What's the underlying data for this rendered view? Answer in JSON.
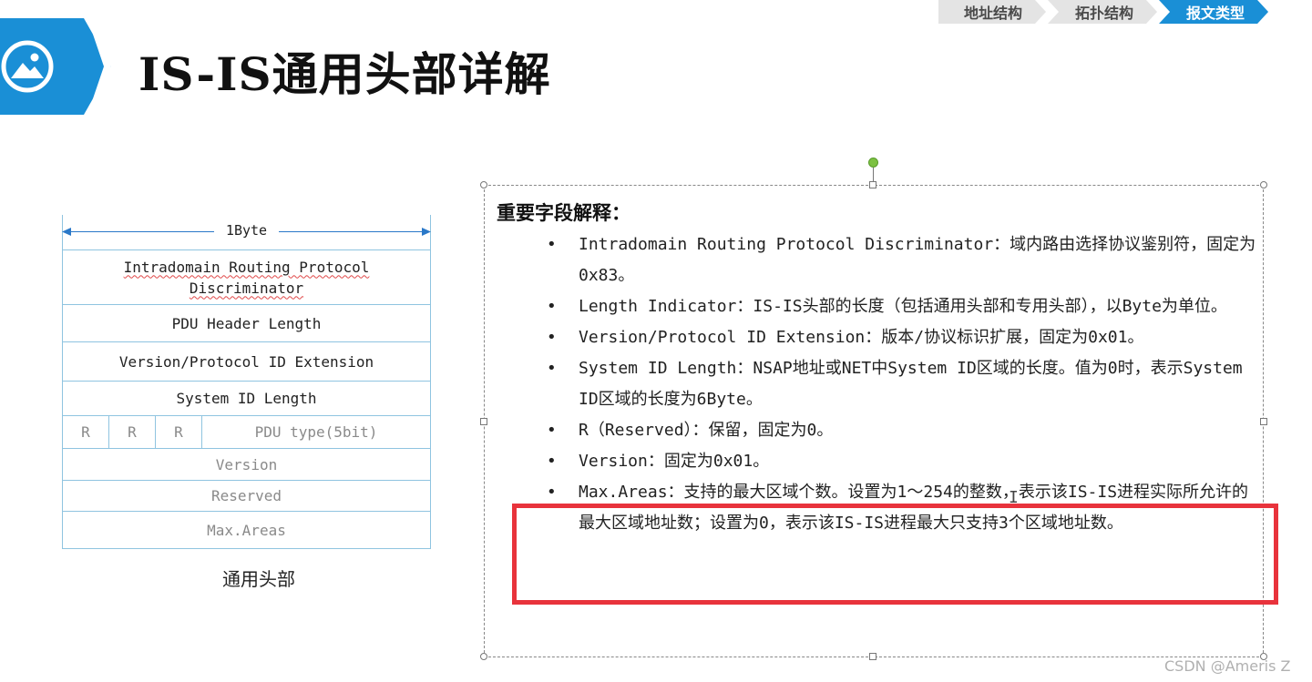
{
  "breadcrumb": [
    {
      "label": "地址结构",
      "active": false
    },
    {
      "label": "拓扑结构",
      "active": false
    },
    {
      "label": "报文类型",
      "active": true
    }
  ],
  "header": {
    "title": "IS-IS通用头部详解",
    "icon": "image-icon",
    "accent_color": "#1a8fd6"
  },
  "diagram": {
    "byte_label": "1Byte",
    "rows": [
      {
        "label": "Intradomain Routing Protocol Discriminator",
        "muted": false
      },
      {
        "label": "PDU Header Length",
        "muted": false
      },
      {
        "label": "Version/Protocol ID Extension",
        "muted": false
      },
      {
        "label": "System ID Length",
        "muted": false
      }
    ],
    "bit_row": {
      "r_labels": [
        "R",
        "R",
        "R"
      ],
      "pdu_type": "PDU type(5bit)"
    },
    "tail_rows": [
      "Version",
      "Reserved",
      "Max.Areas"
    ],
    "caption": "通用头部"
  },
  "explanation": {
    "title": "重要字段解释：",
    "items": [
      "Intradomain Routing Protocol Discriminator：域内路由选择协议鉴别符，固定为0x83。",
      "Length Indicator：IS-IS头部的长度（包括通用头部和专用头部），以Byte为单位。",
      "Version/Protocol ID Extension：版本/协议标识扩展，固定为0x01。",
      "System ID Length：NSAP地址或NET中System ID区域的长度。值为0时，表示System ID区域的长度为6Byte。",
      "R（Reserved）：保留，固定为0。",
      "Version：固定为0x01。",
      "Max.Areas：支持的最大区域个数。设置为1～254的整数，表示该IS-IS进程实际所允许的最大区域地址数；设置为0，表示该IS-IS进程最大只支持3个区域地址数。"
    ],
    "highlight_color": "#e8333c"
  },
  "watermark": "CSDN @Ameris Z"
}
